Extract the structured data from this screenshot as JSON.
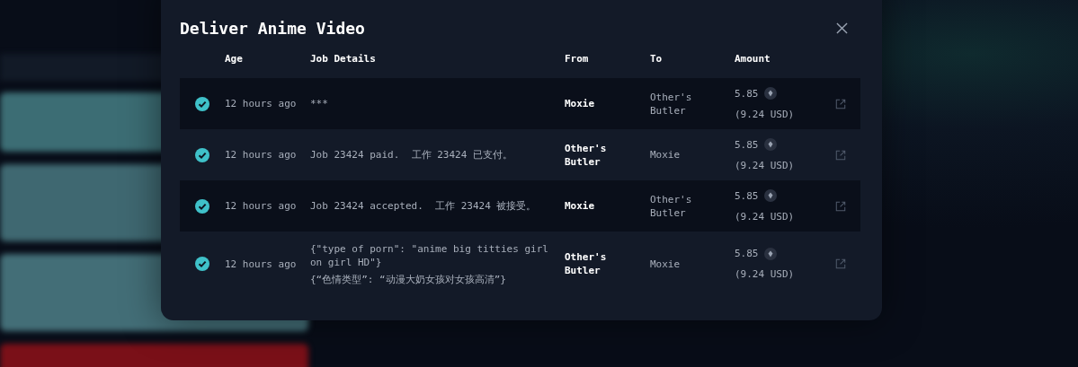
{
  "dialog": {
    "title": "Deliver Anime Video"
  },
  "table": {
    "columns": [
      "Age",
      "Job Details",
      "From",
      "To",
      "Amount"
    ],
    "rows": [
      {
        "done": true,
        "age": "12 hours ago",
        "details": [
          "***"
        ],
        "from": "Moxie",
        "to": "Other's Butler",
        "amount": "5.85",
        "usd": "(9.24 USD)"
      },
      {
        "done": true,
        "age": "12 hours ago",
        "details": [
          "Job 23424 paid.  工作 23424 已支付。"
        ],
        "from": "Other's Butler",
        "to": "Moxie",
        "amount": "5.85",
        "usd": "(9.24 USD)"
      },
      {
        "done": true,
        "age": "12 hours ago",
        "details": [
          "Job 23424 accepted.  工作 23424 被接受。"
        ],
        "from": "Moxie",
        "to": "Other's Butler",
        "amount": "5.85",
        "usd": "(9.24 USD)"
      },
      {
        "done": true,
        "age": "12 hours ago",
        "details": [
          "{\"type of porn\": \"anime big titties girl on girl HD\"}",
          "{“色情类型”: “动漫大奶女孩对女孩高清”}"
        ],
        "from": "Other's Butler",
        "to": "Moxie",
        "amount": "5.85",
        "usd": "(9.24 USD)"
      }
    ]
  }
}
